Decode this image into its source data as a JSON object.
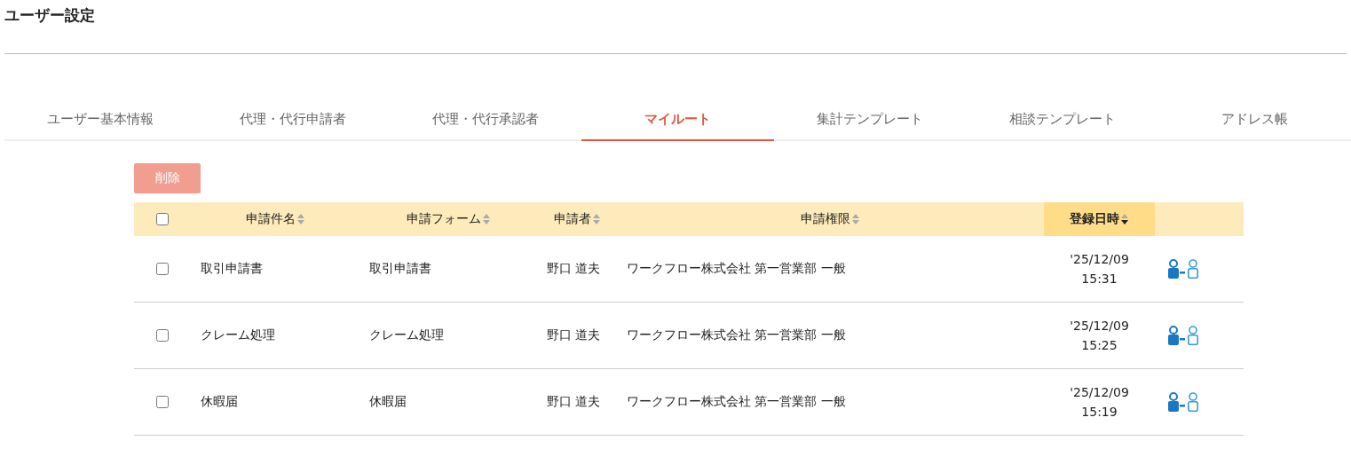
{
  "page": {
    "title": "ユーザー設定"
  },
  "tabs": [
    {
      "label": "ユーザー基本情報",
      "selected": false
    },
    {
      "label": "代理・代行申請者",
      "selected": false
    },
    {
      "label": "代理・代行承認者",
      "selected": false
    },
    {
      "label": "マイルート",
      "selected": true
    },
    {
      "label": "集計テンプレート",
      "selected": false
    },
    {
      "label": "相談テンプレート",
      "selected": false
    },
    {
      "label": "アドレス帳",
      "selected": false
    }
  ],
  "delete_button": {
    "label": "削除",
    "disabled": true
  },
  "table": {
    "select_all": {
      "checked": false
    },
    "columns": [
      {
        "label": "申請件名",
        "sorted": false
      },
      {
        "label": "申請フォーム",
        "sorted": false
      },
      {
        "label": "申請者",
        "sorted": false
      },
      {
        "label": "申請権限",
        "sorted": false
      },
      {
        "label": "登録日時",
        "sorted": true
      }
    ],
    "rows": [
      {
        "selected": false,
        "name": "取引申請書",
        "form": "取引申請書",
        "applicant": "野口 道夫",
        "authority": "ワークフロー株式会社 第一営業部 一般",
        "date": "'25/12/09",
        "time": "15:31"
      },
      {
        "selected": false,
        "name": "クレーム処理",
        "form": "クレーム処理",
        "applicant": "野口 道夫",
        "authority": "ワークフロー株式会社 第一営業部 一般",
        "date": "'25/12/09",
        "time": "15:25"
      },
      {
        "selected": false,
        "name": "休暇届",
        "form": "休暇届",
        "applicant": "野口 道夫",
        "authority": "ワークフロー株式会社 第一営業部 一般",
        "date": "'25/12/09",
        "time": "15:19"
      }
    ]
  }
}
